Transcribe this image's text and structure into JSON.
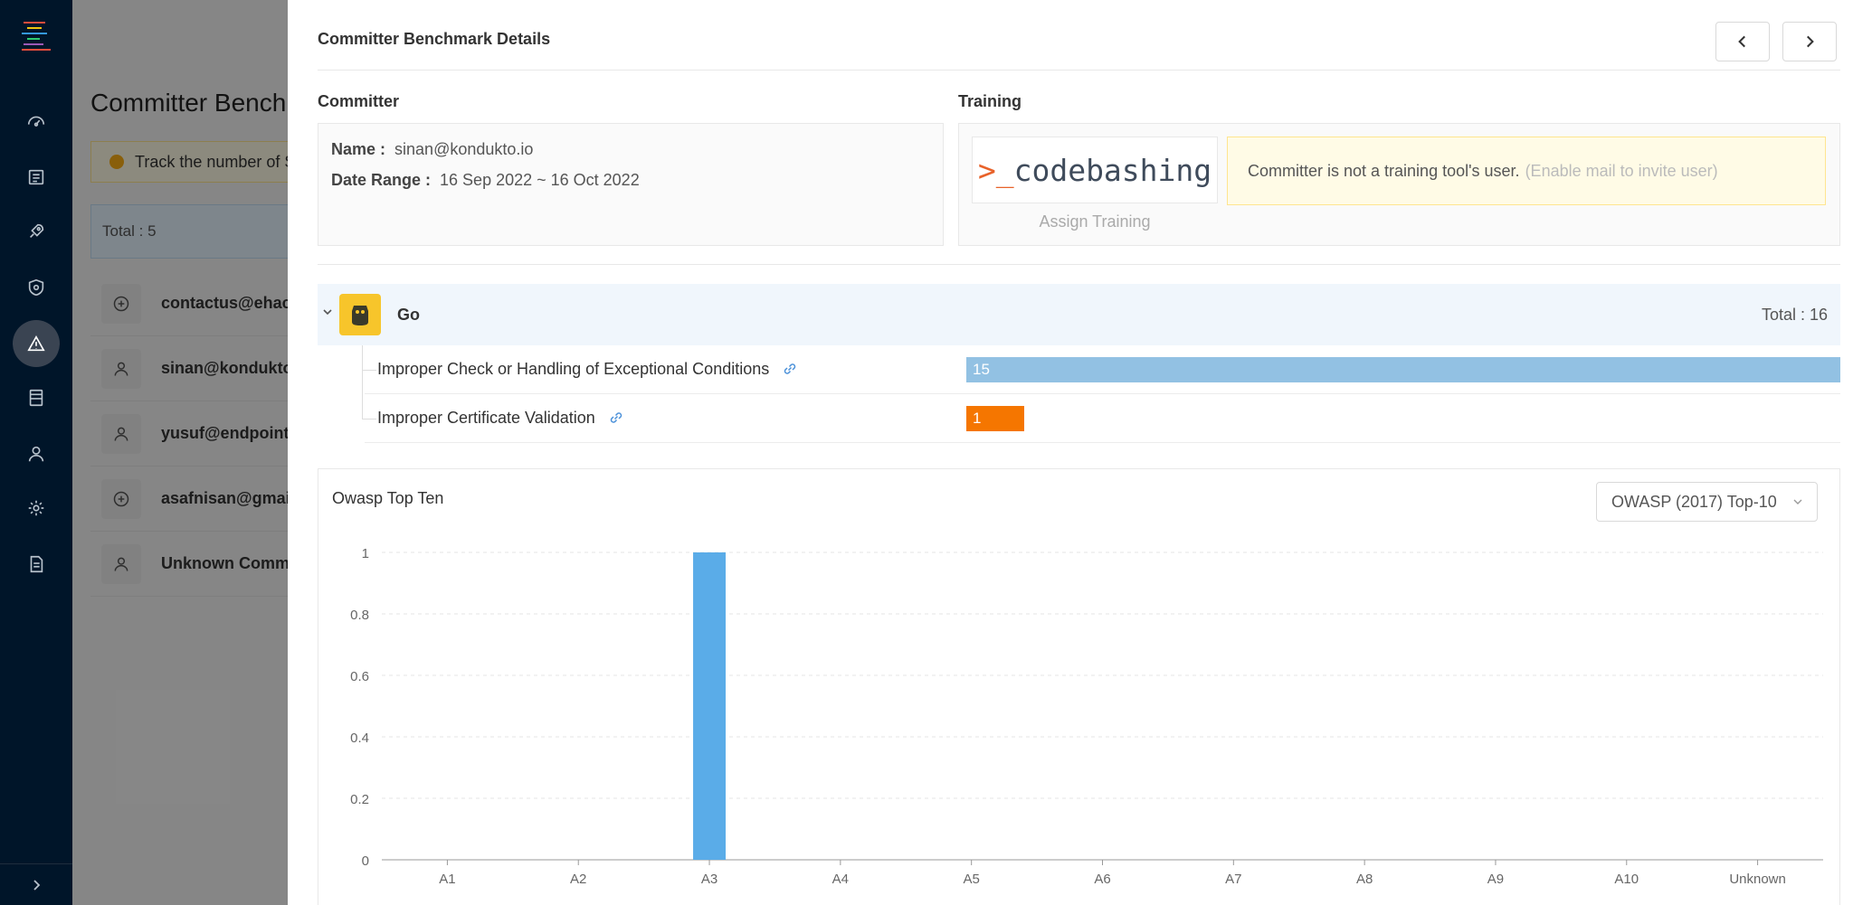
{
  "background": {
    "title": "Committer Benchm",
    "alert": "Track the number of S",
    "total": "Total : 5",
    "rows": [
      {
        "name": "contactus@ehack",
        "icon": "plus-circle-icon"
      },
      {
        "name": "sinan@kondukto",
        "icon": "user-icon"
      },
      {
        "name": "yusuf@endpoint-",
        "icon": "user-icon"
      },
      {
        "name": "asafnisan@gmail",
        "icon": "plus-circle-icon"
      },
      {
        "name": "Unknown Commi",
        "icon": "user-icon"
      }
    ]
  },
  "drawer": {
    "title": "Committer Benchmark Details",
    "committer_label": "Committer",
    "training_label": "Training",
    "name_label": "Name :",
    "name_value": "sinan@kondukto.io",
    "date_label": "Date Range :",
    "date_value": "16 Sep 2022 ~ 16 Oct 2022",
    "logo_prompt": ">_",
    "logo_word": "codebashing",
    "assign_training": "Assign Training",
    "training_msg": "Committer is not a training tool's user.",
    "training_hint": "(Enable mail to invite user)",
    "language": {
      "name": "Go",
      "total": "Total : 16"
    },
    "vulnerabilities": [
      {
        "name": "Improper Check or Handling of Exceptional Conditions",
        "count": 15,
        "color": "#92c1e3"
      },
      {
        "name": "Improper Certificate Validation",
        "count": 1,
        "color": "#f57600"
      }
    ]
  },
  "chart_title": "Owasp Top Ten",
  "select_value": "OWASP (2017) Top-10",
  "chart_data": {
    "type": "bar",
    "categories": [
      "A1",
      "A2",
      "A3",
      "A4",
      "A5",
      "A6",
      "A7",
      "A8",
      "A9",
      "A10",
      "Unknown"
    ],
    "values": [
      0,
      0,
      1,
      0,
      0,
      0,
      0,
      0,
      0,
      0,
      0
    ],
    "ylim": [
      0,
      1
    ],
    "yticks": [
      "0",
      "0.2",
      "0.4",
      "0.6",
      "0.8",
      "1"
    ],
    "grid": true,
    "bar_color": "#5aace8"
  },
  "colors": {
    "sidebar": "#001529",
    "accent": "#5aace8",
    "warning": "#faad14"
  }
}
